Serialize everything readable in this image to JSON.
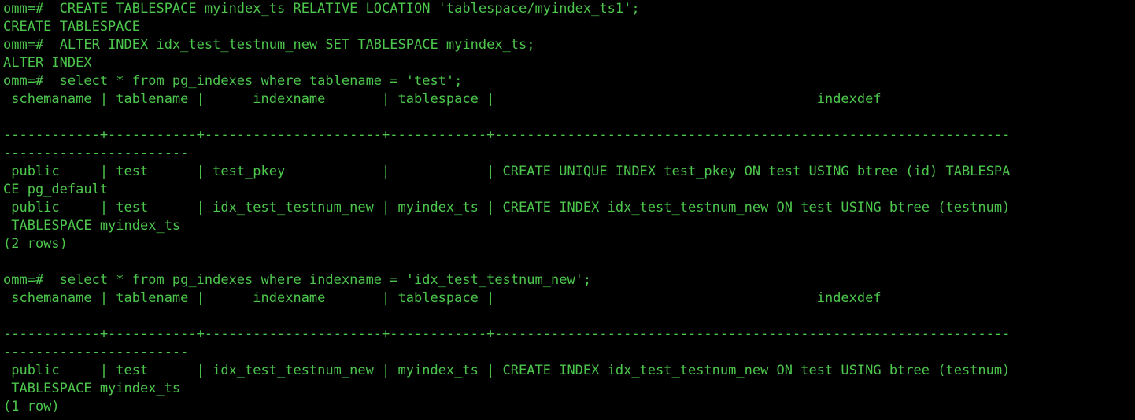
{
  "terminal": {
    "lines": [
      "omm=#  CREATE TABLESPACE myindex_ts RELATIVE LOCATION 'tablespace/myindex_ts1';",
      "CREATE TABLESPACE",
      "omm=#  ALTER INDEX idx_test_testnum_new SET TABLESPACE myindex_ts;",
      "ALTER INDEX",
      "omm=#  select * from pg_indexes where tablename = 'test';",
      " schemaname | tablename |      indexname       | tablespace |                                        indexdef",
      "",
      "------------+-----------+----------------------+------------+----------------------------------------------------------------",
      "-----------------------",
      " public     | test      | test_pkey            |            | CREATE UNIQUE INDEX test_pkey ON test USING btree (id) TABLESPA",
      "CE pg_default",
      " public     | test      | idx_test_testnum_new | myindex_ts | CREATE INDEX idx_test_testnum_new ON test USING btree (testnum)",
      " TABLESPACE myindex_ts",
      "(2 rows)",
      "",
      "omm=#  select * from pg_indexes where indexname = 'idx_test_testnum_new';",
      " schemaname | tablename |      indexname       | tablespace |                                        indexdef",
      "",
      "------------+-----------+----------------------+------------+----------------------------------------------------------------",
      "-----------------------",
      " public     | test      | idx_test_testnum_new | myindex_ts | CREATE INDEX idx_test_testnum_new ON test USING btree (testnum)",
      " TABLESPACE myindex_ts",
      "(1 row)"
    ]
  },
  "colors": {
    "background": "#000000",
    "text": "#4cc64c"
  }
}
